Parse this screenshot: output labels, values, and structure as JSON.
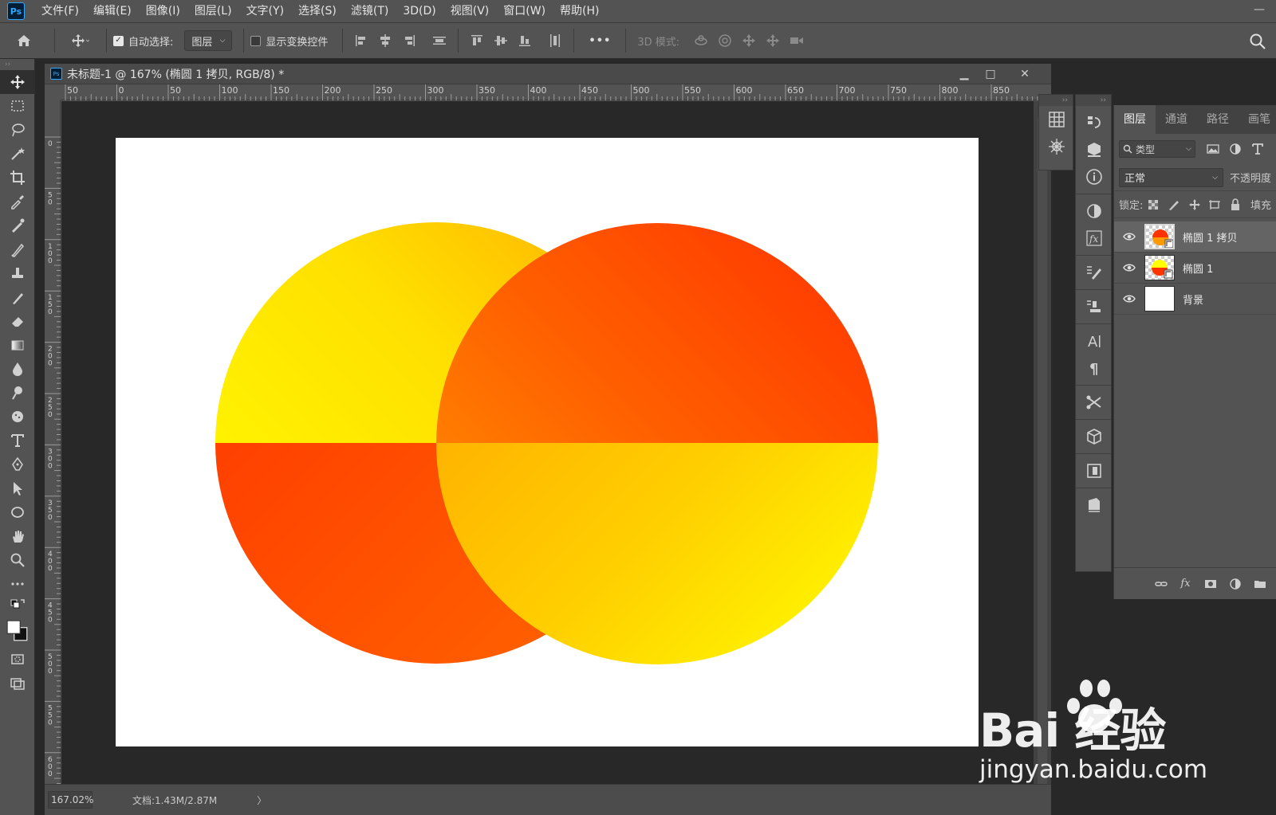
{
  "app": {
    "logo_text": "Ps"
  },
  "menu": [
    {
      "label": "文件(F)"
    },
    {
      "label": "编辑(E)"
    },
    {
      "label": "图像(I)"
    },
    {
      "label": "图层(L)"
    },
    {
      "label": "文字(Y)"
    },
    {
      "label": "选择(S)"
    },
    {
      "label": "滤镜(T)"
    },
    {
      "label": "3D(D)"
    },
    {
      "label": "视图(V)"
    },
    {
      "label": "窗口(W)"
    },
    {
      "label": "帮助(H)"
    }
  ],
  "options": {
    "auto_select_label": "自动选择:",
    "auto_select_checked": true,
    "auto_select_target": "图层",
    "show_transform_label": "显示变换控件",
    "show_transform_checked": false,
    "more_label": "•••",
    "mode_3d_label": "3D 模式:"
  },
  "document": {
    "tab_icon_text": "Ps",
    "title": "未标题-1 @ 167% (椭圆 1 拷贝, RGB/8) *",
    "ruler_h_ticks": [
      "50",
      "0",
      "50",
      "100",
      "150",
      "200",
      "250",
      "300",
      "350",
      "400",
      "450",
      "500",
      "550",
      "600",
      "650",
      "700",
      "750",
      "800",
      "850"
    ],
    "ruler_v_ticks": [
      "0",
      "5\n0",
      "1\n0\n0",
      "1\n5\n0",
      "2\n0\n0",
      "2\n5\n0",
      "3\n0\n0",
      "3\n5\n0",
      "4\n0\n0",
      "4\n5\n0",
      "5\n0\n0",
      "5\n5\n0",
      "6\n0\n0"
    ],
    "zoom": "167.02%",
    "doc_size": "文档:1.43M/2.87M",
    "status_arrow": "〉"
  },
  "layers_panel": {
    "tabs": [
      {
        "label": "图层",
        "active": true
      },
      {
        "label": "通道",
        "active": false
      },
      {
        "label": "路径",
        "active": false
      },
      {
        "label": "画笔",
        "active": false
      }
    ],
    "filter_label": "类型",
    "blend_mode": "正常",
    "opacity_label": "不透明度",
    "lock_label": "锁定:",
    "fill_label": "填充",
    "layers": [
      {
        "name": "椭圆 1 拷贝",
        "selected": true,
        "type": "shape"
      },
      {
        "name": "椭圆 1",
        "selected": false,
        "type": "shape"
      },
      {
        "name": "背景",
        "selected": false,
        "type": "background"
      }
    ],
    "footer_fx": "fx"
  },
  "colors": {
    "ui_bg": "#535353",
    "pasteboard": "#282828",
    "yellow": "#ffff00",
    "red": "#ff3300",
    "orange": "#ff9a00"
  },
  "watermark": {
    "brand": "Bai 经验",
    "url": "jingyan.baidu.com"
  }
}
